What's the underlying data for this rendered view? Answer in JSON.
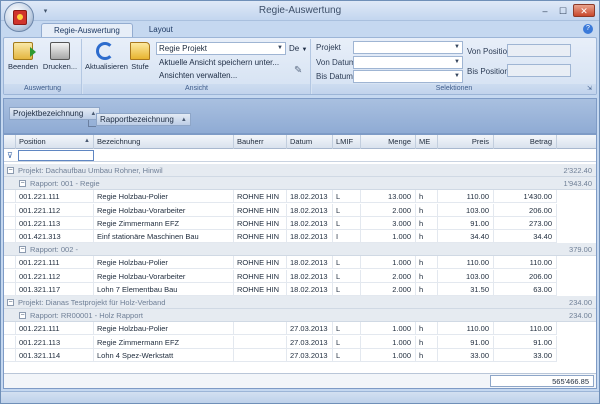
{
  "window": {
    "title": "Regie-Auswertung",
    "min": "–",
    "max": "☐",
    "close": "✕"
  },
  "tabs": [
    {
      "label": "Regie-Auswertung"
    },
    {
      "label": "Layout"
    }
  ],
  "ribbon": {
    "auswertung": {
      "label": "Auswertung",
      "beenden": "Beenden",
      "drucken": "Drucken..."
    },
    "ansicht": {
      "label": "Ansicht",
      "aktualisieren": "Aktualisieren",
      "stufe": "Stufe",
      "view_select": "Regie Projekt",
      "de_label": "De",
      "save_view": "Aktuelle Ansicht speichern unter...",
      "manage_views": "Ansichten verwalten..."
    },
    "selektionen": {
      "label": "Selektionen",
      "projekt": "Projekt",
      "von_datum": "Von Datum",
      "bis_datum": "Bis Datum",
      "von_position": "Von Position",
      "bis_position": "Bis Position"
    }
  },
  "grouping": {
    "chip1": "Projektbezeichnung",
    "chip2": "Rapportbezeichnung"
  },
  "columns": [
    "Position",
    "Bezeichnung",
    "Bauherr",
    "Datum",
    "LMIF",
    "Menge",
    "ME",
    "Preis",
    "Betrag"
  ],
  "rows": [
    {
      "type": "g1",
      "text": "Projekt: Dachaufbau Umbau Rohner, Hinwil",
      "sum": "2'322.40"
    },
    {
      "type": "g2",
      "text": "Rapport: 001 - Regie",
      "sum": "1'943.40"
    },
    {
      "type": "d",
      "cells": [
        "001.221.111",
        "Regie Holzbau-Polier",
        "ROHNE HIN",
        "18.02.2013",
        "L",
        "13.000",
        "h",
        "110.00",
        "1'430.00"
      ]
    },
    {
      "type": "d",
      "cells": [
        "001.221.112",
        "Regie Holzbau-Vorarbeiter",
        "ROHNE HIN",
        "18.02.2013",
        "L",
        "2.000",
        "h",
        "103.00",
        "206.00"
      ]
    },
    {
      "type": "d",
      "cells": [
        "001.221.113",
        "Regie Zimmermann EFZ",
        "ROHNE HIN",
        "18.02.2013",
        "L",
        "3.000",
        "h",
        "91.00",
        "273.00"
      ]
    },
    {
      "type": "d",
      "cells": [
        "001.421.313",
        "Einf stationäre Maschinen Bau",
        "ROHNE HIN",
        "18.02.2013",
        "I",
        "1.000",
        "h",
        "34.40",
        "34.40"
      ]
    },
    {
      "type": "g2",
      "text": "Rapport: 002 -",
      "sum": "379.00"
    },
    {
      "type": "d",
      "cells": [
        "001.221.111",
        "Regie Holzbau-Polier",
        "ROHNE HIN",
        "18.02.2013",
        "L",
        "1.000",
        "h",
        "110.00",
        "110.00"
      ]
    },
    {
      "type": "d",
      "cells": [
        "001.221.112",
        "Regie Holzbau-Vorarbeiter",
        "ROHNE HIN",
        "18.02.2013",
        "L",
        "2.000",
        "h",
        "103.00",
        "206.00"
      ]
    },
    {
      "type": "d",
      "cells": [
        "001.321.117",
        "Lohn 7 Elementbau Bau",
        "ROHNE HIN",
        "18.02.2013",
        "L",
        "2.000",
        "h",
        "31.50",
        "63.00"
      ]
    },
    {
      "type": "g1",
      "text": "Projekt: Dianas Testprojekt für Holz-Verband",
      "sum": "234.00"
    },
    {
      "type": "g2",
      "text": "Rapport: RR00001 - Holz Rapport",
      "sum": "234.00"
    },
    {
      "type": "d",
      "cells": [
        "001.221.111",
        "Regie Holzbau-Polier",
        "",
        "27.03.2013",
        "L",
        "1.000",
        "h",
        "110.00",
        "110.00"
      ]
    },
    {
      "type": "d",
      "cells": [
        "001.221.113",
        "Regie Zimmermann EFZ",
        "",
        "27.03.2013",
        "L",
        "1.000",
        "h",
        "91.00",
        "91.00"
      ]
    },
    {
      "type": "d",
      "cells": [
        "001.321.114",
        "Lohn 4 Spez-Werkstatt",
        "",
        "27.03.2013",
        "L",
        "1.000",
        "h",
        "33.00",
        "33.00"
      ]
    }
  ],
  "footer": {
    "total": "565'466.85"
  }
}
